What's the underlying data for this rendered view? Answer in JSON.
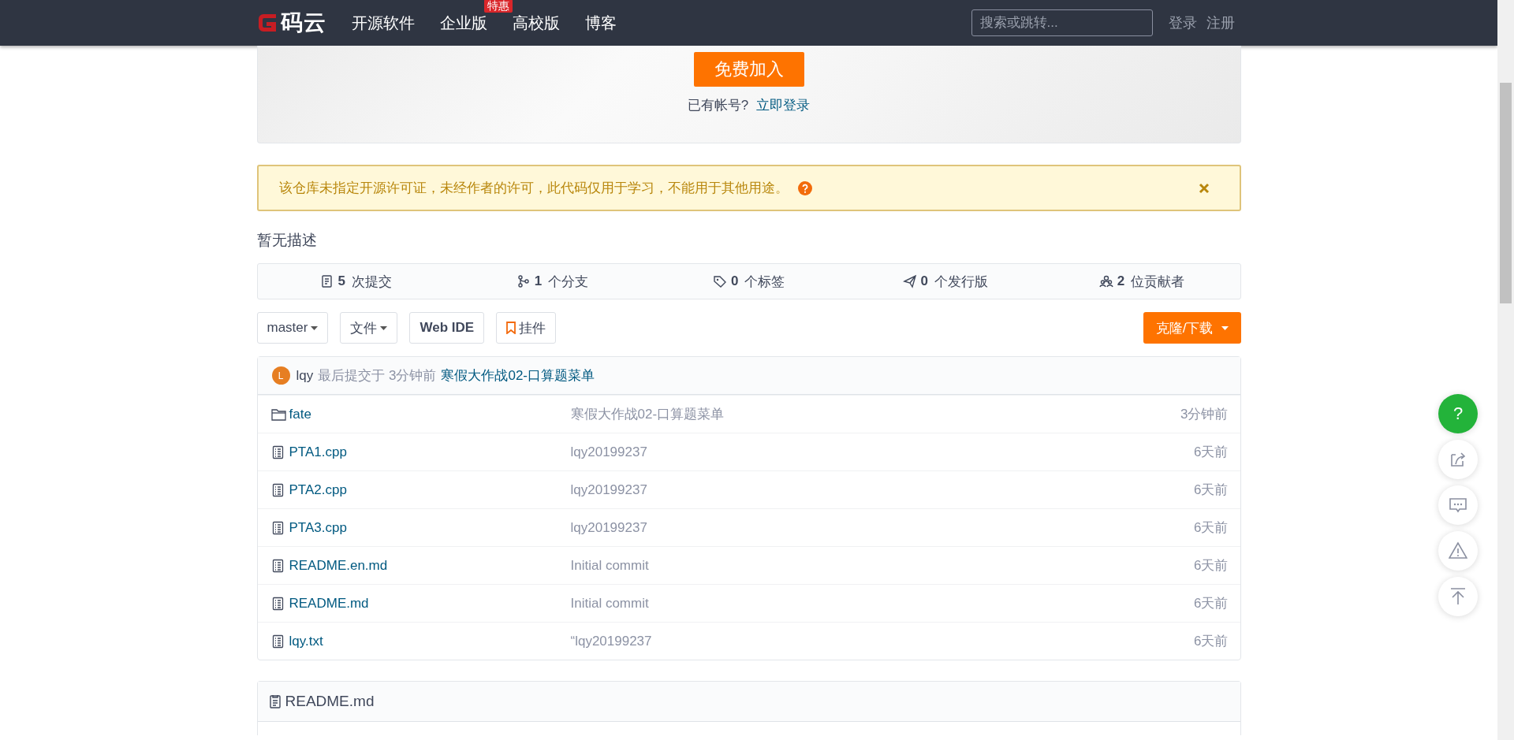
{
  "nav": {
    "logo_text": "码云",
    "items": [
      {
        "label": "开源软件"
      },
      {
        "label": "企业版",
        "badge": "特惠"
      },
      {
        "label": "高校版"
      },
      {
        "label": "博客"
      }
    ],
    "search": {
      "placeholder": "搜索或跳转..."
    },
    "links": [
      "登录",
      "注册"
    ]
  },
  "banner": {
    "join_button": "免费加入",
    "prompt": "已有帐号?",
    "login_link": "立即登录"
  },
  "alert": {
    "text": "该仓库未指定开源许可证，未经作者的许可，此代码仅用于学习，不能用于其他用途。"
  },
  "description": "暂无描述",
  "stats": [
    {
      "kind": "commits",
      "count": "5",
      "label": "次提交"
    },
    {
      "kind": "branches",
      "count": "1",
      "label": "个分支"
    },
    {
      "kind": "tags",
      "count": "0",
      "label": "个标签"
    },
    {
      "kind": "releases",
      "count": "0",
      "label": "个发行版"
    },
    {
      "kind": "contributors",
      "count": "2",
      "label": "位贡献者"
    }
  ],
  "toolbar": {
    "branch": "master",
    "files": "文件",
    "web_ide": "Web IDE",
    "widget": "挂件",
    "clone": "克隆/下载"
  },
  "last_commit": {
    "avatar": "L",
    "author": "lqy",
    "info": "最后提交于 3分钟前",
    "message": "寒假大作战02-口算题菜单"
  },
  "files": [
    {
      "kind": "folder",
      "name": "fate",
      "message": "寒假大作战02-口算题菜单",
      "time": "3分钟前"
    },
    {
      "kind": "file",
      "name": "PTA1.cpp",
      "message": "lqy20199237",
      "time": "6天前"
    },
    {
      "kind": "file",
      "name": "PTA2.cpp",
      "message": "lqy20199237",
      "time": "6天前"
    },
    {
      "kind": "file",
      "name": "PTA3.cpp",
      "message": "lqy20199237",
      "time": "6天前"
    },
    {
      "kind": "file",
      "name": "README.en.md",
      "message": "Initial commit",
      "time": "6天前"
    },
    {
      "kind": "file",
      "name": "README.md",
      "message": "Initial commit",
      "time": "6天前"
    },
    {
      "kind": "file",
      "name": "lqy.txt",
      "message": "“lqy20199237",
      "time": "6天前"
    }
  ],
  "readme": {
    "title": "README.md"
  },
  "float_buttons": [
    {
      "kind": "help",
      "label": "?"
    },
    {
      "kind": "share"
    },
    {
      "kind": "comment"
    },
    {
      "kind": "report"
    },
    {
      "kind": "top"
    }
  ]
}
